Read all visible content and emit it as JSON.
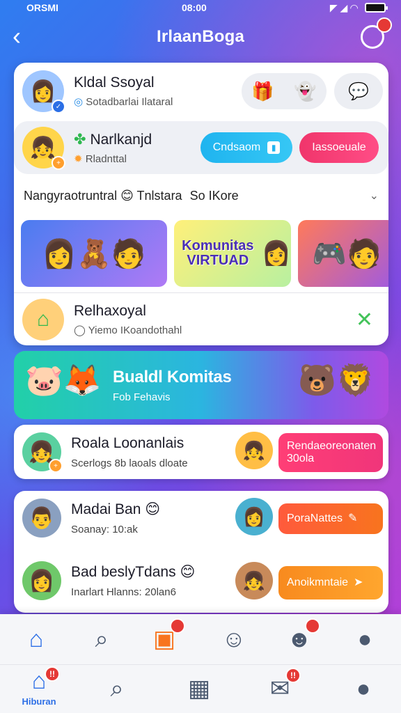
{
  "status": {
    "time": "08:00",
    "left_text": "ORSMI",
    "signal_glyphs": "◤ ◢ ◠"
  },
  "header": {
    "title": "IrlaanBoga",
    "back_label": "‹",
    "notif_badge": ""
  },
  "profile": {
    "name": "Kldal Ssoyal",
    "subtitle": "Sotadbarlai Ilataral"
  },
  "friend_card": {
    "name": "Narlkanjd",
    "subtitle": "Rladnttal",
    "primary_button": "Cndsaom",
    "secondary_button": "Iassoeuale"
  },
  "section": {
    "title": "Nangyraotruntral",
    "tag1": "Tnlstara",
    "tag2": "So IKore"
  },
  "thumbnails": [
    {
      "label": ""
    },
    {
      "label": "Komunitas VIRTUAD"
    },
    {
      "label": ""
    }
  ],
  "group_row": {
    "name": "Relhaxoyal",
    "subtitle": "Yiemo IKoandothahl"
  },
  "banner": {
    "title": "Bualdl Komitas",
    "subtitle": "Fob Fehavis"
  },
  "list": [
    {
      "name": "Roala Loonanlais",
      "subtitle": "Scerlogs 8b laoals dloate",
      "action": "Rendaeoreonaten 30ola"
    },
    {
      "name": "Madai Ban",
      "subtitle": "Soanay: 10:ak",
      "action": "PoraNattes"
    },
    {
      "name": "Bad beslyTdans",
      "subtitle": "Inarlart Hlanns: 20lan6",
      "action": "Anoikmntaie"
    }
  ],
  "dock_top": [
    {
      "icon": "home-icon",
      "glyph": "⌂",
      "badge": ""
    },
    {
      "icon": "search-icon",
      "glyph": "⌕",
      "badge": ""
    },
    {
      "icon": "gift-icon",
      "glyph": "▣",
      "badge": ""
    },
    {
      "icon": "cat-icon",
      "glyph": "☺",
      "badge": ""
    },
    {
      "icon": "ghost-icon",
      "glyph": "☻",
      "badge": ""
    },
    {
      "icon": "profile-icon",
      "glyph": "●",
      "badge": ""
    }
  ],
  "dock_bottom": [
    {
      "icon": "home-icon",
      "glyph": "⌂",
      "label": "Hiburan",
      "badge": "!!"
    },
    {
      "icon": "search-icon",
      "glyph": "⌕",
      "label": "",
      "badge": ""
    },
    {
      "icon": "news-icon",
      "glyph": "▦",
      "label": "",
      "badge": ""
    },
    {
      "icon": "chat-icon",
      "glyph": "✉",
      "label": "",
      "badge": "!!"
    },
    {
      "icon": "profile-icon",
      "glyph": "●",
      "label": "",
      "badge": ""
    }
  ],
  "colors": {
    "accent_blue": "#1fb4ef",
    "accent_pink": "#f0356b",
    "accent_orange": "#f8741e",
    "badge_red": "#e53935"
  }
}
